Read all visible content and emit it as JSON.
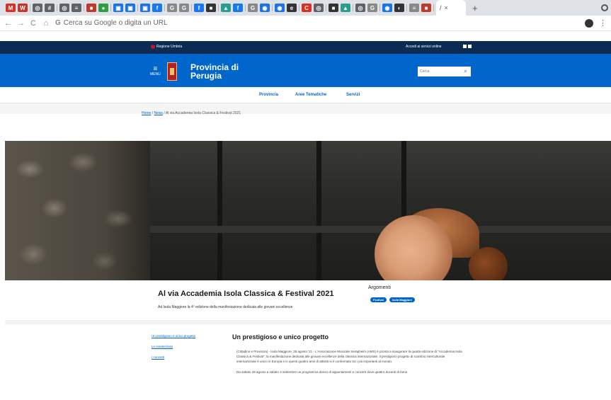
{
  "browser": {
    "tab_favicons": [
      {
        "icon": "gmail-icon",
        "color": "#d93025",
        "glyph": "M"
      },
      {
        "icon": "app-icon",
        "color": "#c0392b",
        "glyph": "W"
      },
      {
        "icon": "globe-icon",
        "color": "#5f6368",
        "glyph": "◎"
      },
      {
        "icon": "app-icon",
        "color": "#5f6368",
        "glyph": "#"
      },
      {
        "icon": "globe-icon",
        "color": "#5f6368",
        "glyph": "◎"
      },
      {
        "icon": "app-icon",
        "color": "#5f6368",
        "glyph": "≡"
      },
      {
        "icon": "app-icon",
        "color": "#c0392b",
        "glyph": "■"
      },
      {
        "icon": "app-icon",
        "color": "#2e9e44",
        "glyph": "●"
      },
      {
        "icon": "app-icon",
        "color": "#1a73e8",
        "glyph": "▣"
      },
      {
        "icon": "app-icon",
        "color": "#1a73e8",
        "glyph": "▣"
      },
      {
        "icon": "app-icon",
        "color": "#1a73e8",
        "glyph": "▣"
      },
      {
        "icon": "facebook-icon",
        "color": "#1877f2",
        "glyph": "f"
      },
      {
        "icon": "google-icon",
        "color": "#888888",
        "glyph": "G"
      },
      {
        "icon": "google-icon",
        "color": "#888888",
        "glyph": "G"
      },
      {
        "icon": "facebook-icon",
        "color": "#1877f2",
        "glyph": "f"
      },
      {
        "icon": "app-icon",
        "color": "#333333",
        "glyph": "■"
      },
      {
        "icon": "app-icon",
        "color": "#2a9d8f",
        "glyph": "▲"
      },
      {
        "icon": "facebook-icon",
        "color": "#1877f2",
        "glyph": "f"
      },
      {
        "icon": "google-icon",
        "color": "#888888",
        "glyph": "G"
      },
      {
        "icon": "app-icon",
        "color": "#1a73e8",
        "glyph": "◉"
      },
      {
        "icon": "app-icon",
        "color": "#1a73e8",
        "glyph": "◉"
      },
      {
        "icon": "app-icon",
        "color": "#333333",
        "glyph": "e"
      },
      {
        "icon": "app-icon",
        "color": "#d93025",
        "glyph": "C"
      },
      {
        "icon": "globe-icon",
        "color": "#5f6368",
        "glyph": "◎"
      },
      {
        "icon": "app-icon",
        "color": "#333333",
        "glyph": "■"
      },
      {
        "icon": "app-icon",
        "color": "#2a9d8f",
        "glyph": "▲"
      },
      {
        "icon": "globe-icon",
        "color": "#5f6368",
        "glyph": "◎"
      },
      {
        "icon": "google-icon",
        "color": "#888888",
        "glyph": "G"
      },
      {
        "icon": "app-icon",
        "color": "#1a73e8",
        "glyph": "◉"
      },
      {
        "icon": "app-icon",
        "color": "#333333",
        "glyph": "◐"
      },
      {
        "icon": "app-icon",
        "color": "#888888",
        "glyph": "≡"
      },
      {
        "icon": "app-icon",
        "color": "#c0392b",
        "glyph": "■"
      }
    ],
    "active_tab": {
      "close": "×",
      "glyph": "/"
    },
    "new_tab": "+",
    "back": "←",
    "forward": "→",
    "reload": "C",
    "home": "⌂",
    "omnibox_g": "G",
    "address_placeholder": "Cerca su Google o digita un URL",
    "menu": "⋮"
  },
  "site": {
    "region_label": "Regione Umbria",
    "access_services": "Accedi ai servizi online",
    "menu_label": "MENU",
    "menu_glyph": "≡",
    "title_line1": "Provincia di",
    "title_line2": "Perugia",
    "search_placeholder": "Cerca",
    "search_glyph": "⌕",
    "nav": [
      "Provincia",
      "Aree Tematiche",
      "Servizi"
    ]
  },
  "breadcrumb": {
    "home": "Home",
    "sep1": "/",
    "news": "News",
    "sep2": "/",
    "current": "Al via Accademia Isola Classica & Festival 2021"
  },
  "article": {
    "title": "Al via Accademia Isola Classica & Festival 2021",
    "subtitle": "Ad Isola Maggiore la 4° edizione della manifestazione dedicata alle giovani eccellenze",
    "topics_label": "Argomenti",
    "topics": [
      "Festival",
      "Isola Maggiore"
    ],
    "toc": [
      "Un prestigioso e unico progetto",
      "Le masterclass",
      "I concerti"
    ],
    "section_title": "Un prestigioso e unico progetto",
    "paragraphs": [
      "(Cittadino e Provincia) - Isola Maggiore, 26 agosto '21 - L'Associazione Musicale Serapheim (AMS) è pronta a inaugurare la quarta edizione di \"Accademia Isola Classica & Festival\", la manifestazione dedicata alle giovani eccellenze della classica internazionale. Il prestigioso progetto di scambio interculturale internazionale è unico in Europa e in questi quattro anni di attività si è confermato tra i più importanti al mondo.",
      "Da sabato 28 agosto a sabato 4 settembre un programma denso di appuntamenti e concerti dove quattro docenti di fama"
    ]
  }
}
